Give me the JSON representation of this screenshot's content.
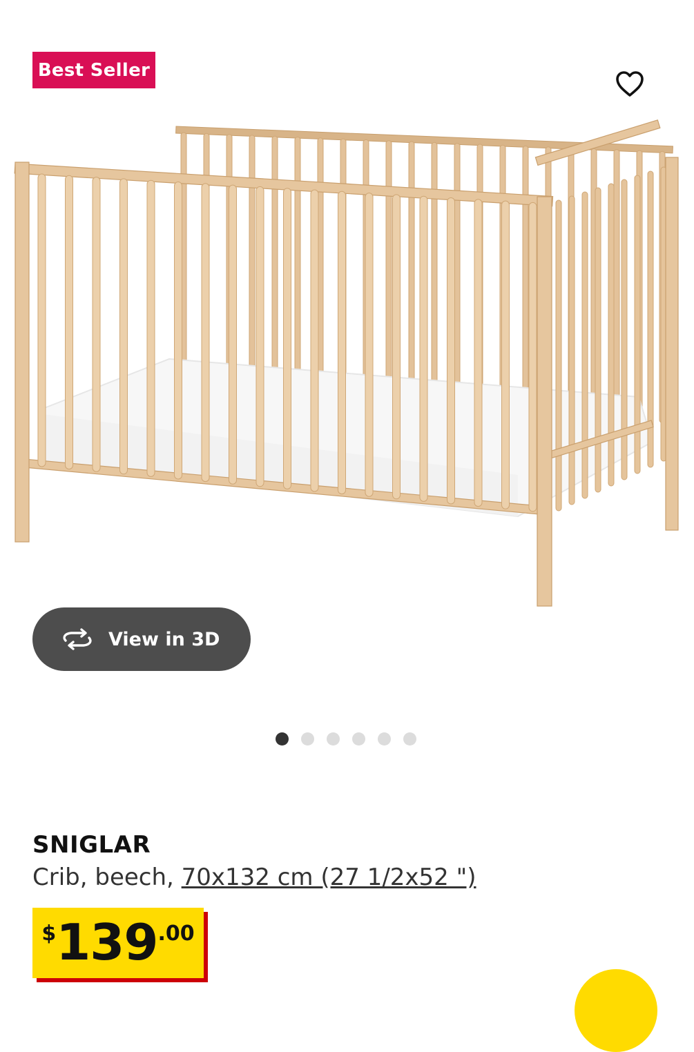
{
  "badge": {
    "label": "Best Seller",
    "color": "#d90f55"
  },
  "favorite": {
    "icon": "heart-outline-icon"
  },
  "view3d": {
    "label": "View in 3D",
    "icon": "rotate-3d-icon"
  },
  "carousel": {
    "total": 6,
    "active_index": 0
  },
  "product": {
    "name": "SNIGLAR",
    "desc_prefix": "Crib, beech, ",
    "size": "70x132 cm (27 1/2x52 \")",
    "price": {
      "currency": "$",
      "integer": "139",
      "decimal": ".00"
    }
  },
  "colors": {
    "accent_yellow": "#ffdb00",
    "price_shadow": "#cc0008",
    "dark_button": "#4d4d4d"
  }
}
